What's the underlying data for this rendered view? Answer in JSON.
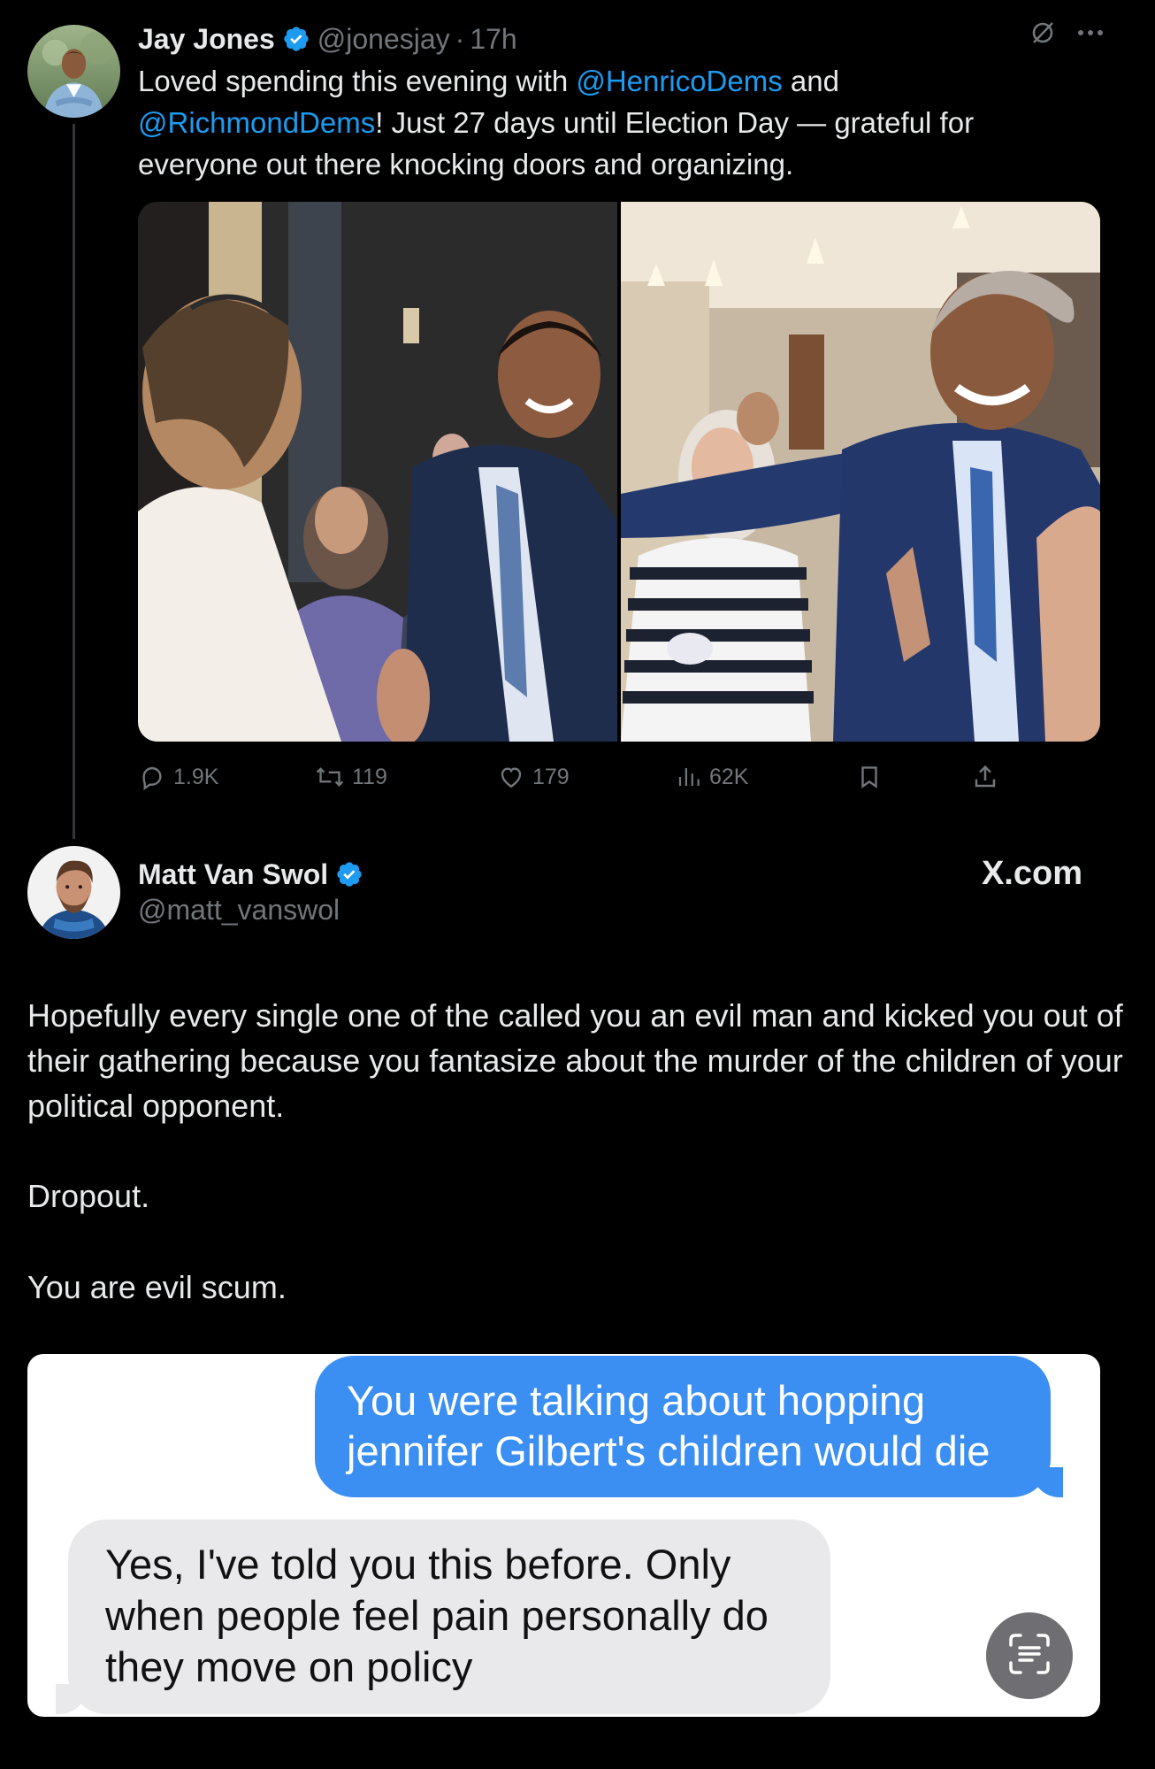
{
  "tweet1": {
    "author_name": "Jay Jones",
    "handle": "@jonesjay",
    "separator": "·",
    "time": "17h",
    "text_start": "Loved spending this evening with ",
    "mention1": "@HenricoDems",
    "text_mid": " and ",
    "mention2": "@RichmondDems",
    "text_end": "! Just 27 days until Election Day — grateful for everyone out there knocking doors and  organizing.",
    "stats": {
      "replies": "1.9K",
      "reposts": "119",
      "likes": "179",
      "views": "62K"
    }
  },
  "tweet2": {
    "author_name": "Matt Van Swol",
    "handle": "@matt_vanswol",
    "watermark": "X.com",
    "paragraph1": "Hopefully every single one of the called you an evil man and kicked you out of their gathering because you fantasize about the murder of the children of your political opponent.",
    "paragraph2": "Dropout.",
    "paragraph3": "You are evil scum."
  },
  "embedded_messages": {
    "sent": "You were talking about hopping jennifer Gilbert's children would die",
    "received": "Yes, I've told you this before. Only when people feel pain personally do they move on policy"
  },
  "colors": {
    "background": "#000000",
    "link": "#1d9bf0",
    "muted": "#71767b",
    "verified": "#1d9bf0",
    "imessage_blue": "#3b8ff2"
  }
}
